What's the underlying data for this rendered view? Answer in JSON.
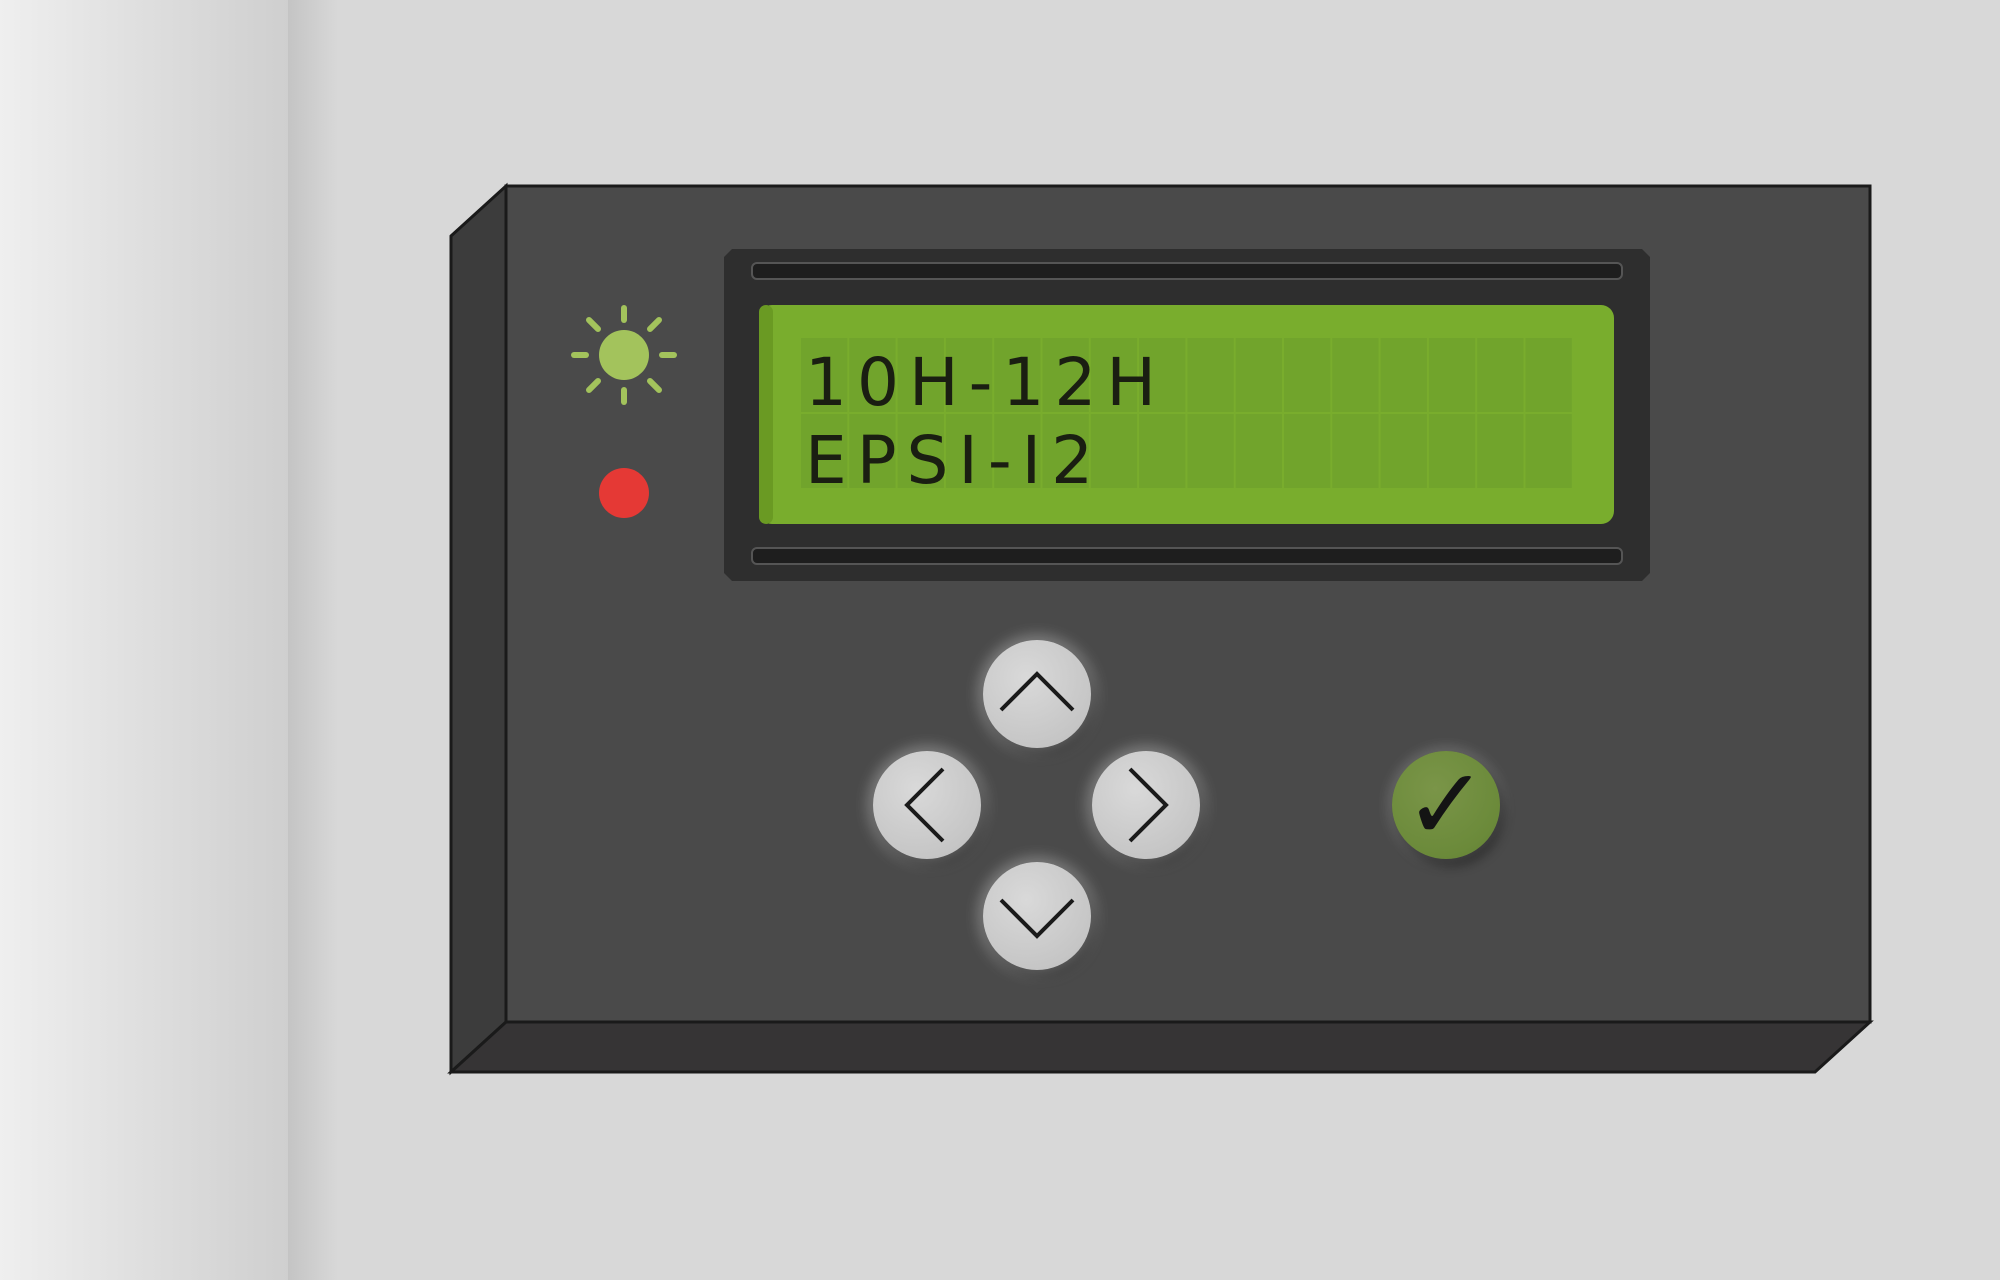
{
  "display": {
    "line1": "10H-12H",
    "line2": "EPSI-I2",
    "backlight_color": "#79ad2d",
    "text_color": "#1a1e12"
  },
  "indicators": {
    "power_light": {
      "icon": "sun-icon",
      "color": "#a3c35c"
    },
    "alarm_light": {
      "icon": "red-dot-icon",
      "color": "#e53935"
    }
  },
  "controls": {
    "up_icon": "chevron-up-icon",
    "down_icon": "chevron-down-icon",
    "left_icon": "chevron-left-icon",
    "right_icon": "chevron-right-icon",
    "confirm_glyph": "✓",
    "confirm_color": "#6b8a3a"
  },
  "device": {
    "housing_color": "#4a4a4a",
    "bezel_color": "#2e2e2e"
  }
}
